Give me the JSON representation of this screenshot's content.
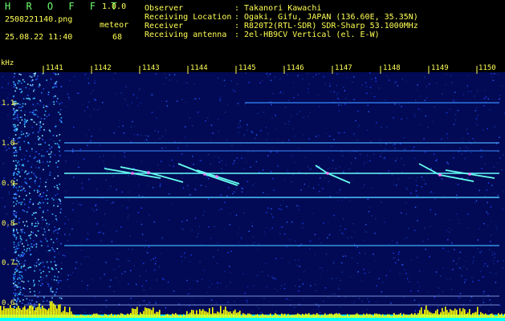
{
  "header": {
    "logo": "H R O F F T",
    "version": "1.0.0",
    "file_name": "2508221140.png",
    "mode": "meteor",
    "datetime": "25.08.22 11:40",
    "count": "68"
  },
  "info": {
    "rows": [
      {
        "label": "Observer",
        "value": ": Takanori Kawachi"
      },
      {
        "label": "Receiving Location",
        "value": ": Ogaki, Gifu, JAPAN (136.60E, 35.35N)"
      },
      {
        "label": "Receiver",
        "value": ": R820T2(RTL-SDR) SDR-Sharp 53.1000MHz"
      },
      {
        "label": "Receiving antenna",
        "value": ": 2el-HB9CV Vertical (el. E-W)"
      }
    ]
  },
  "spectrogram": {
    "unit_label": "kHz",
    "time_labels": [
      "1141",
      "1142",
      "1143",
      "1144",
      "1145",
      "1146",
      "1147",
      "1148",
      "1149",
      "1150"
    ],
    "freq_labels": [
      "1.1",
      "1.0",
      "0.9",
      "0.8",
      "0.7",
      "0.6"
    ]
  },
  "colors": {
    "background": "#000000",
    "text": "#ffff55",
    "logo": "#6cff6c",
    "noise": "#1b3cff",
    "carrier": "#66ffff",
    "meteor": "#ff77ff",
    "level_bars": "#ffff00",
    "baseline": "#00ffff"
  }
}
